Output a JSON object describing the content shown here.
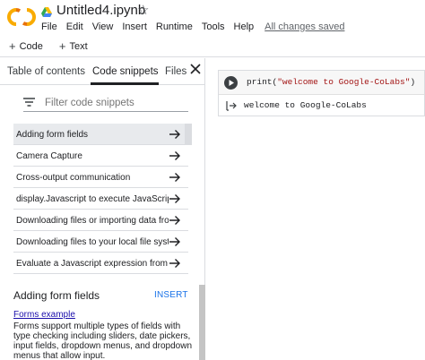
{
  "header": {
    "logo_text": "CO",
    "title": "Untitled4.ipynb",
    "star": "☆",
    "menu": [
      "File",
      "Edit",
      "View",
      "Insert",
      "Runtime",
      "Tools",
      "Help"
    ],
    "saved_status": "All changes saved"
  },
  "toolbar": {
    "code_label": "Code",
    "text_label": "Text"
  },
  "sidebar": {
    "tabs": [
      "Table of contents",
      "Code snippets",
      "Files"
    ],
    "active_tab": "Code snippets",
    "filter_placeholder": "Filter code snippets",
    "snippets": [
      "Adding form fields",
      "Camera Capture",
      "Cross-output communication",
      "display.Javascript to execute JavaScript fro...",
      "Downloading files or importing data from...",
      "Downloading files to your local file system",
      "Evaluate a Javascript expression from Py..."
    ],
    "selected_index": 0,
    "detail": {
      "title": "Adding form fields",
      "insert_label": "INSERT",
      "link": "Forms example",
      "description": "Forms support multiple types of fields with type checking including sliders, date pickers, input fields, dropdown menus, and dropdown menus that allow input."
    }
  },
  "cell": {
    "code_fn": "print(",
    "code_str": "\"welcome to Google-CoLabs\"",
    "code_close": ")",
    "output": "welcome to Google-CoLabs"
  },
  "colors": {
    "logo_orange": "#f9ab00",
    "logo_dark_orange": "#e8710a",
    "link_blue": "#1a73e8",
    "string_red": "#a31515"
  }
}
